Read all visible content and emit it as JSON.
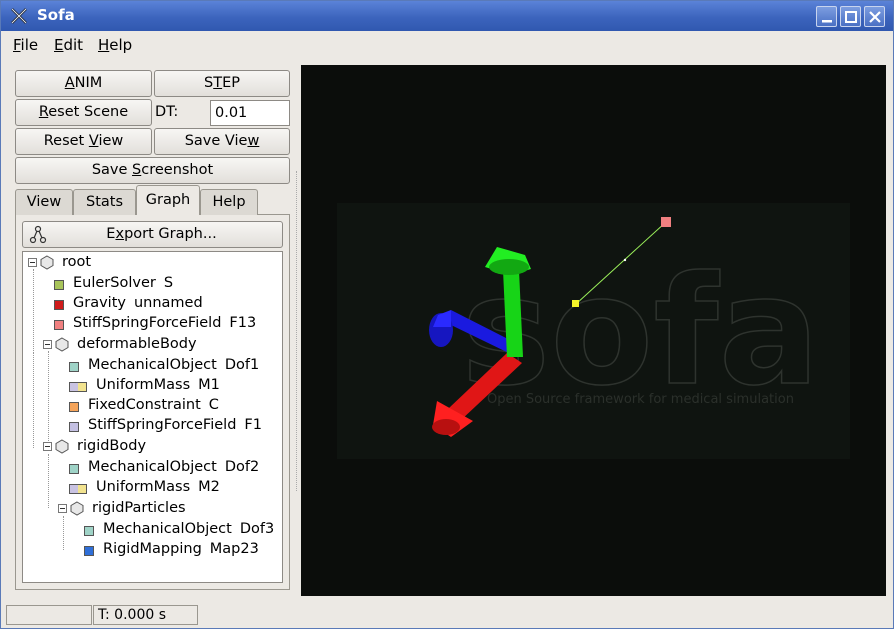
{
  "window": {
    "title": "Sofa"
  },
  "menu": [
    {
      "label": "File",
      "u": "F",
      "rest": "ile"
    },
    {
      "label": "Edit",
      "u": "E",
      "rest": "dit"
    },
    {
      "label": "Help",
      "u": "H",
      "rest": "elp"
    }
  ],
  "controls": {
    "anim": {
      "u": "A",
      "rest": "NIM"
    },
    "step": {
      "pre": "S",
      "u": "T",
      "rest": "EP"
    },
    "reset_scene": {
      "u": "R",
      "rest": "eset Scene"
    },
    "dt_label": "DT:",
    "dt_value": "0.01",
    "reset_view": {
      "pre": "Reset ",
      "u": "V",
      "rest": "iew"
    },
    "save_view": {
      "pre": "Save Vie",
      "u": "w",
      "rest": ""
    },
    "save_screenshot": {
      "pre": "Save ",
      "u": "S",
      "rest": "creenshot"
    }
  },
  "tabs": [
    "View",
    "Stats",
    "Graph",
    "Help"
  ],
  "active_tab": "Graph",
  "export_graph": {
    "pre": "E",
    "u": "x",
    "rest": "port Graph..."
  },
  "tree": [
    {
      "type": "root",
      "name": "root",
      "detail": ""
    },
    {
      "type": "EulerSolver",
      "name": "S",
      "color": "#a8c45a"
    },
    {
      "type": "Gravity",
      "name": "unnamed",
      "color": "#d01c1c"
    },
    {
      "type": "StiffSpringForceField",
      "name": "F13",
      "color": "#f08080"
    },
    {
      "type": "deformableBody",
      "name": ""
    },
    {
      "type": "MechanicalObject",
      "name": "Dof1",
      "color": "#9fd3c7"
    },
    {
      "type": "UniformMass",
      "name": "M1",
      "color": "split"
    },
    {
      "type": "FixedConstraint",
      "name": "C",
      "color": "#f5a45a"
    },
    {
      "type": "StiffSpringForceField",
      "name": "F1",
      "color": "#c4c0e2"
    },
    {
      "type": "rigidBody",
      "name": ""
    },
    {
      "type": "MechanicalObject",
      "name": "Dof2",
      "color": "#9fd3c7"
    },
    {
      "type": "UniformMass",
      "name": "M2",
      "color": "split"
    },
    {
      "type": "rigidParticles",
      "name": ""
    },
    {
      "type": "MechanicalObject",
      "name": "Dof3",
      "color": "#9fd3c7"
    },
    {
      "type": "RigidMapping",
      "name": "Map23",
      "color": "#2f6fd8"
    }
  ],
  "viewport": {
    "watermark": "sofa",
    "watermark_sub": "Open Source framework for medical simulation"
  },
  "status": {
    "left": "",
    "time": "T: 0.000 s"
  }
}
